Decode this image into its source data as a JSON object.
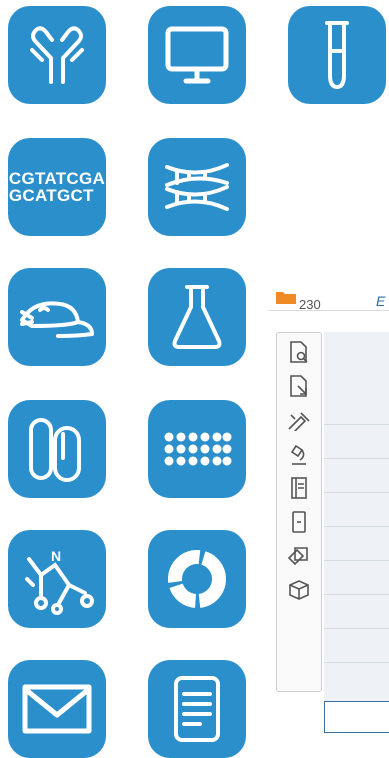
{
  "tiles": [
    {
      "name": "antibody-icon"
    },
    {
      "name": "monitor-icon"
    },
    {
      "name": "test-tube-icon"
    },
    {
      "name": "dna-sequence-icon",
      "text": "CGTATCGA\nGCATGCT"
    },
    {
      "name": "dna-helix-icon"
    },
    {
      "name": "mouse-icon"
    },
    {
      "name": "flask-icon"
    },
    {
      "name": "capsules-icon"
    },
    {
      "name": "well-plate-icon"
    },
    {
      "name": "molecule-icon"
    },
    {
      "name": "donut-chart-icon"
    },
    {
      "name": "envelope-icon"
    },
    {
      "name": "document-icon"
    }
  ],
  "panel": {
    "folder_count": "230",
    "tab_letter": "E",
    "tools": [
      "search-document-icon",
      "edit-document-icon",
      "pipette-icon",
      "microscope-icon",
      "notebook-icon",
      "device-icon",
      "tag-box-icon",
      "package-icon"
    ]
  },
  "colors": {
    "tile": "#2b8fcc",
    "folder": "#f08a24"
  }
}
